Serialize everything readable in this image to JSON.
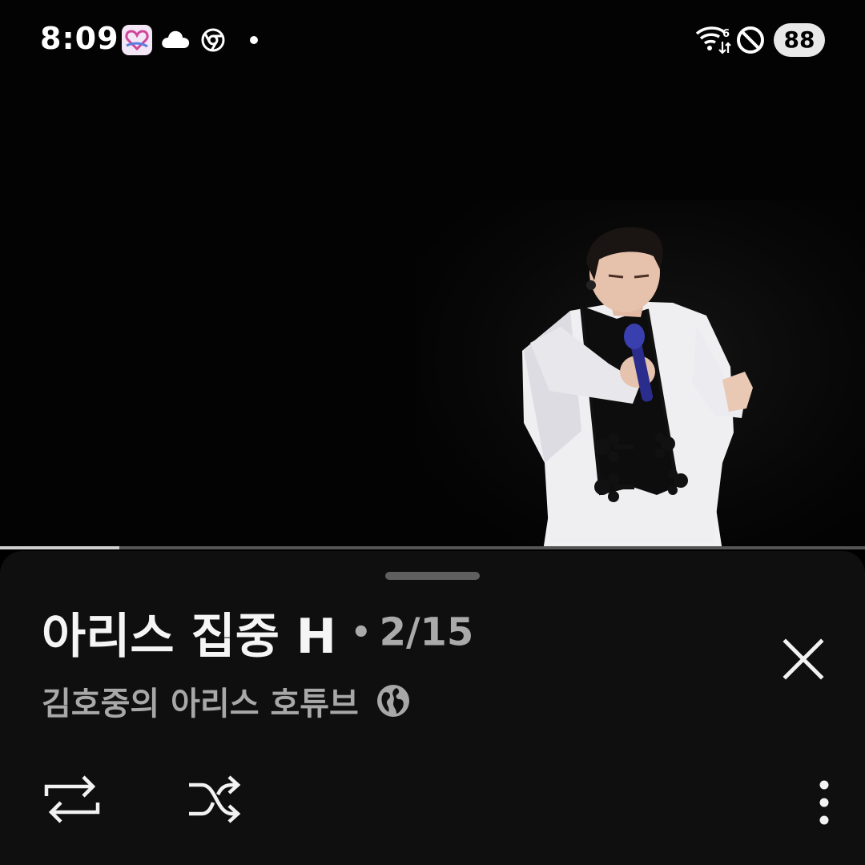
{
  "status_bar": {
    "time": "8:09",
    "battery": "88",
    "icons": [
      "heart-app-icon",
      "cloud-icon",
      "chrome-icon",
      "notification-dot-icon",
      "wifi-6-icon",
      "do-not-disturb-icon"
    ]
  },
  "video": {
    "progress_fraction": 0.138
  },
  "playlist": {
    "title": "아리스 집중 H",
    "separator": "•",
    "position": "2/15",
    "channel": "김호중의 아리스 호튜브",
    "visibility_icon": "globe-icon"
  },
  "controls": {
    "close_icon": "close-icon",
    "loop_icon": "loop-icon",
    "shuffle_icon": "shuffle-icon",
    "more_icon": "more-vert-icon"
  },
  "colors": {
    "sheet_background": "#0f0f0f",
    "progress_fill": "#cfcfcf",
    "secondary_text": "#aaaaaa"
  }
}
